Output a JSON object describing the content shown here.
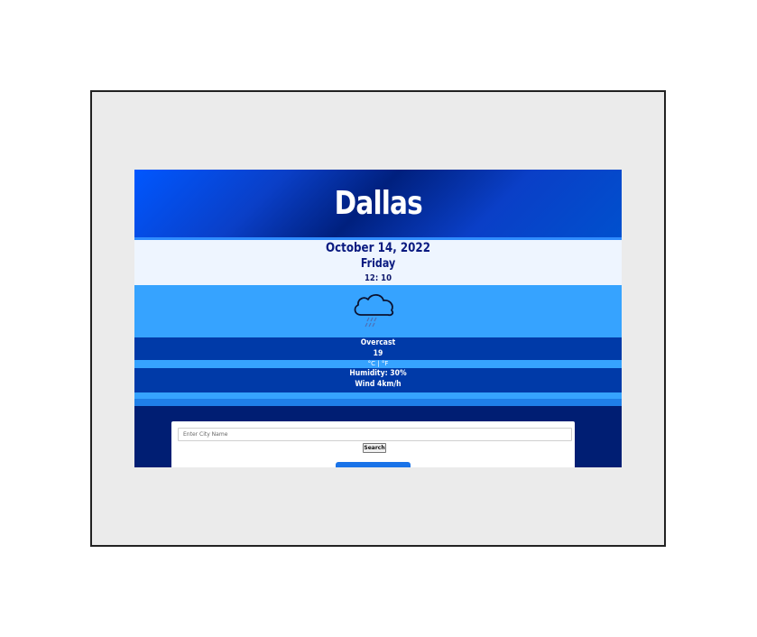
{
  "weather": {
    "city": "Dallas",
    "date": "October 14, 2022",
    "day": "Friday",
    "time": "12: 10",
    "icon": "rain-cloud-icon",
    "condition": "Overcast",
    "temperature": "19",
    "units": "°C | °F",
    "humidity": "Humidity: 30%",
    "wind": "Wind 4km/h"
  },
  "search": {
    "placeholder": "Enter City Name",
    "button_label": "Search"
  },
  "colors": {
    "header": "#0a3fc7",
    "datebox": "#eef5ff",
    "iconbox": "#36a3ff",
    "condbar": "#003aa8",
    "footer": "#001e73"
  }
}
